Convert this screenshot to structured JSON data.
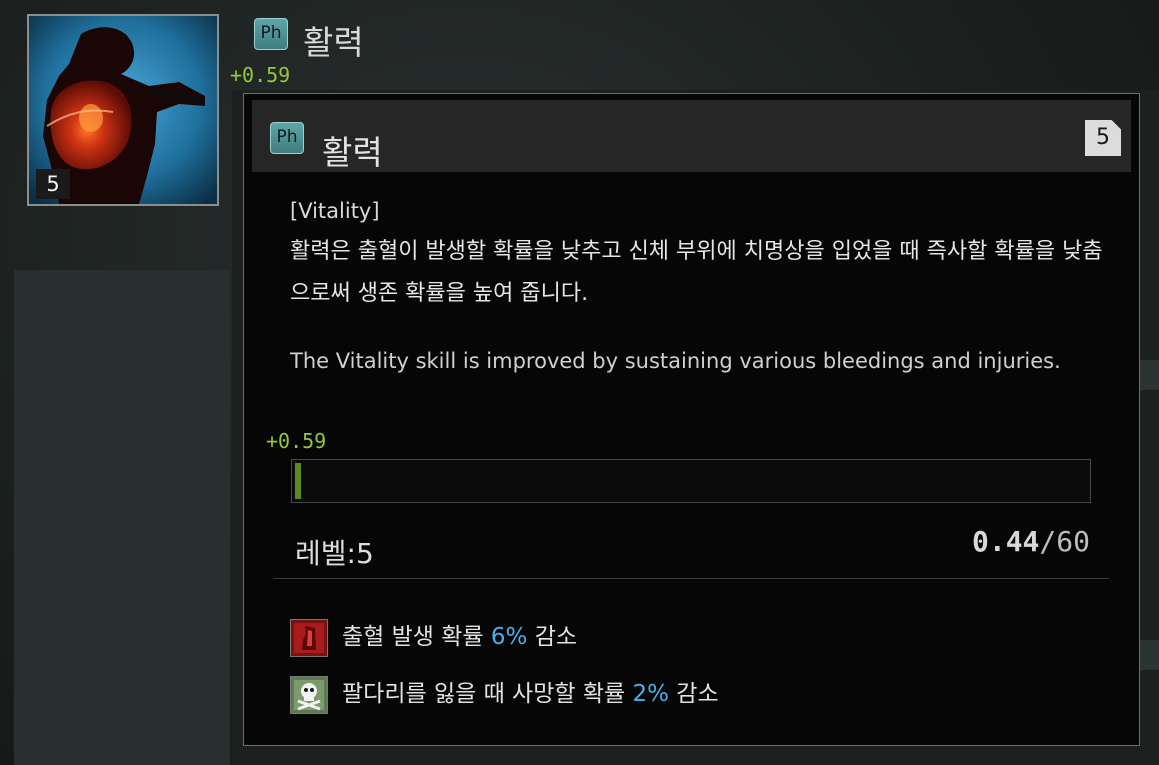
{
  "skill": {
    "category_badge": "Ph",
    "name": "활력",
    "level": "5",
    "gain": "+0.59"
  },
  "tooltip": {
    "category_badge": "Ph",
    "title": "활력",
    "level": "5",
    "bracket_name": "[Vitality]",
    "description_ko": "활력은 출혈이 발생할 확률을 낮추고 신체 부위에 치명상을 입었을 때 즉사할 확률을 낮춤으로써 생존 확률을 높여 줍니다.",
    "description_en": "The Vitality skill is improved by sustaining various bleedings and injuries.",
    "gain": "+0.59",
    "progress": {
      "current": "0.44",
      "max": "/60",
      "fraction": 0.0073
    },
    "level_label": "레벨:5",
    "effects": [
      {
        "icon": "bleeding-icon",
        "text_before": "출혈 발생 확률 ",
        "value": "6%",
        "text_after": " 감소"
      },
      {
        "icon": "skull-crossbones-icon",
        "text_before": "팔다리를 잃을 때 사망할 확률 ",
        "value": "2%",
        "text_after": " 감소"
      }
    ]
  },
  "colors": {
    "gain_green": "#93c838",
    "progress_fill": "#5b8b1e",
    "percent_blue": "#4ab0ea",
    "badge_teal": "#4f9396"
  }
}
